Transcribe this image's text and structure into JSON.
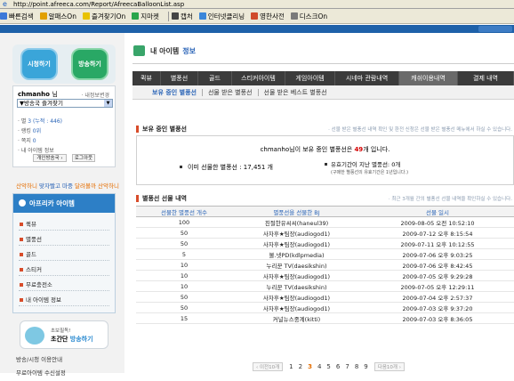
{
  "address_bar": {
    "url": "http://point.afreeca.com/Report/AfreecaBalloonList.asp"
  },
  "links_bar": [
    {
      "label": "빠른검색",
      "icon": "search-icon",
      "color": "#3b78d8"
    },
    {
      "label": "알패스On",
      "icon": "alpass-icon",
      "color": "#e2a000"
    },
    {
      "label": "즐겨찾기On",
      "icon": "star-icon",
      "color": "#e8c200"
    },
    {
      "label": "지마켓",
      "icon": "gmarket-icon",
      "color": "#2aa54b"
    },
    {
      "label": "캡처",
      "icon": "capture-icon",
      "color": "#444444"
    },
    {
      "label": "인터넷클리닝",
      "icon": "cleaning-icon",
      "color": "#3a86d9"
    },
    {
      "label": "영한사전",
      "icon": "dictionary-icon",
      "color": "#d04a2a"
    },
    {
      "label": "디스크On",
      "icon": "disk-icon",
      "color": "#7a7a7a"
    }
  ],
  "sidebar": {
    "watch_button": "시청하기",
    "broadcast_button": "방송하기",
    "user": {
      "name": "chmanho",
      "suffix": "님",
      "change_info": "· 내정보변경"
    },
    "select": {
      "value": "▼방송국 즐겨찾기"
    },
    "stats": [
      {
        "label": "별",
        "value": "3 (누적 : 446)"
      },
      {
        "label": "랭킹",
        "value": "0위"
      },
      {
        "label": "쪽지",
        "value": "0"
      },
      {
        "label": "내 아이템 정보",
        "value": ""
      }
    ],
    "action_buttons": [
      "개인방송국 ›",
      "로그아웃"
    ],
    "live_text_1": "산악하니",
    "live_text_2": "맞자빨고 마중",
    "live_text_3": "달려볼까 산악하니",
    "item_header": "아프리카 아이템",
    "item_menu": [
      "퀵뷰",
      "별풍선",
      "골드",
      "스티커",
      "무료충전소",
      "내 아이템 정보"
    ],
    "promo": {
      "line1": "초보필독!",
      "line2a": "초간단 ",
      "line2b": "방송하기"
    },
    "bottom_links": [
      "방송/시청 이용안내",
      "무료아이템 수신설정"
    ]
  },
  "page": {
    "title": "내 아이템",
    "title_en": "정보",
    "tabs": [
      {
        "label": "퀵뷰",
        "active": false
      },
      {
        "label": "별풍선",
        "active": false
      },
      {
        "label": "골드",
        "active": false
      },
      {
        "label": "스티커아이템",
        "active": false
      },
      {
        "label": "게임아이템",
        "active": false
      },
      {
        "label": "시네마 관람내역",
        "active": false
      },
      {
        "label": "캐쉬이용내역",
        "active": true
      },
      {
        "label": "결제 내역",
        "active": false
      }
    ],
    "subtabs": [
      {
        "label": "보유 중인 별풍선",
        "active": true
      },
      {
        "label": "선물 받은 별풍선",
        "active": false
      },
      {
        "label": "선물 받은 베스트 별풍선",
        "active": false
      }
    ]
  },
  "holding": {
    "heading": "보유 중인 별풍선",
    "note": "· 선물 받은 별풍선 내역 확인 및 환전 신청은 선물 받은 별풍선 메뉴에서 하실 수 있습니다.",
    "line_pre": "chmanho님이 보유 중인 별풍선은 ",
    "line_count": "49",
    "line_post": "개 입니다.",
    "sent_count": "이미 선물한 별풍선 : 17,451 개",
    "expired_count": "유효기간이 지난 별풍선: 0개",
    "expired_note": "(구매한 별풍선의 유효기간은 1년입니다.)"
  },
  "gifts": {
    "heading": "별풍선 선물 내역",
    "note": "· 최근 3개월 간의 별풍선 선물 내역을 확인하실 수 있습니다.",
    "columns": [
      "선물한 별풍선 개수",
      "별풍선을 선물한 BJ",
      "선물 일시"
    ],
    "rows": [
      [
        "100",
        "친절한유씨씨(haneul39)",
        "2009-08-05 오전 10:52:10"
      ],
      [
        "50",
        "사자후★팀장(audiogod1)",
        "2009-07-12 오후 8:15:54"
      ],
      [
        "50",
        "사자후★팀장(audiogod1)",
        "2009-07-11 오후 10:12:55"
      ],
      [
        "5",
        "볼.넷PD(kdlpmedia)",
        "2009-07-06 오후 9:03:25"
      ],
      [
        "10",
        "누리꾼 TV(daesikshin)",
        "2009-07-06 오후 8:42:45"
      ],
      [
        "10",
        "사자후★팀장(audiogod1)",
        "2009-07-05 오후 9:29:28"
      ],
      [
        "10",
        "누리꾼 TV(daesikshin)",
        "2009-07-05 오후 12:29:11"
      ],
      [
        "50",
        "사자후★팀장(audiogod1)",
        "2009-07-04 오후 2:57:37"
      ],
      [
        "50",
        "사자후★팀장(audiogod1)",
        "2009-07-03 오후 9:37:20"
      ],
      [
        "15",
        "커널뉴스중계(kitti)",
        "2009-07-03 오후 8:36:05"
      ]
    ]
  },
  "pager": {
    "prev": "‹ 이전10개",
    "next": "다음10개 ›",
    "pages": [
      "1",
      "2",
      "3",
      "4",
      "5",
      "6",
      "7",
      "8",
      "9"
    ],
    "current": "3"
  }
}
